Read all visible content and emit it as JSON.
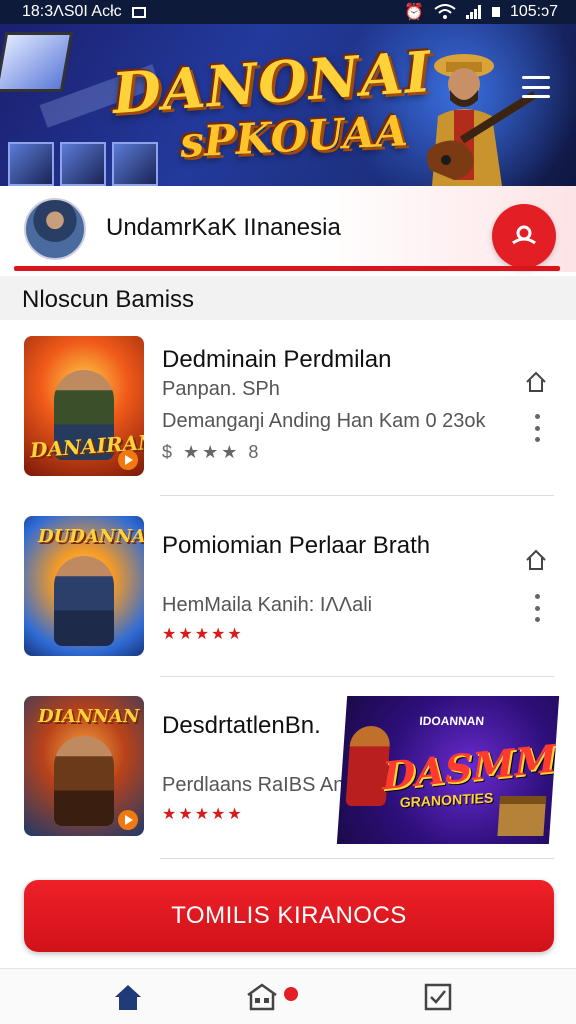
{
  "status_bar": {
    "time": "18:3ΛS0I Acłc",
    "clock": "105:ɔ7",
    "icons": [
      "mail-icon",
      "alarm-icon",
      "wifi-icon",
      "signal-icon",
      "battery-icon"
    ]
  },
  "hero": {
    "logo_line1": "DANONAI",
    "logo_line2": "sPKOUAA",
    "icons": [
      "spotlight-icon",
      "guitarist-illustration",
      "menu-icon"
    ]
  },
  "profile": {
    "name": "UndamrKaK IInanesia",
    "action_icon": "user-icon"
  },
  "section": {
    "title": "Nloscun Bamiss"
  },
  "items": [
    {
      "title": "Dedminain Perdmilan",
      "subtitle": "Panpan. SPh",
      "description": "Demangaŋi Anding Ηan Kam 0 23ok",
      "rating_text": "$ ★★★ 8",
      "thumb_text": "DANAIRAN",
      "thumb_colors": [
        "#f05a1a",
        "#7a1808"
      ]
    },
    {
      "title": "Pomiomian Perlaar Brath",
      "subtitle": "HemMaila Kanih: IΛΛali",
      "rating_stars": 5,
      "rating_text": "★★★★★",
      "thumb_text": "DUDANNAS",
      "thumb_colors": [
        "#2f6bd6",
        "#f39a28"
      ]
    },
    {
      "title": "DesdrtatlenBn.",
      "subtitle": "Perdlaans RaIBS Anth",
      "rating_stars": 5,
      "rating_text": "★★★★★",
      "thumb_text": "DIANNAN",
      "thumb_colors": [
        "#1e3a6a",
        "#e76a1a"
      ]
    }
  ],
  "banner": {
    "top": "IDOANNAN",
    "main": "DASMMIS",
    "sub": "GRANONTIES"
  },
  "cta": {
    "label": "TOMILIS KIRANOCS"
  },
  "bottom_nav": {
    "items": [
      "home-icon",
      "store-icon",
      "checkbox-icon"
    ],
    "accent": "#1f3c78",
    "badge_color": "#e31e25"
  },
  "colors": {
    "brand_red": "#e31e25",
    "hero_blue": "#233a9c",
    "logo_gold": "#ffd23a"
  }
}
